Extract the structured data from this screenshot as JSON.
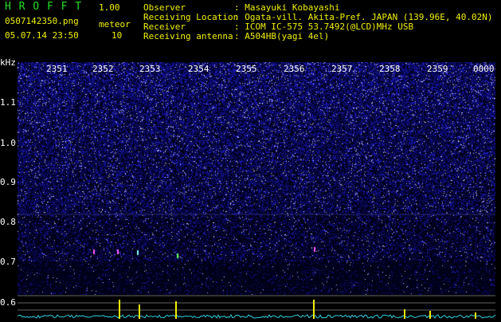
{
  "app": {
    "title": "H R O F F T",
    "version": "1.00"
  },
  "file": {
    "name": "0507142350.png",
    "datetime": "05.07.14 23:50"
  },
  "meteor": {
    "label": "meteor",
    "count": "10"
  },
  "info": [
    {
      "key": "Observer",
      "value": ": Masayuki Kobayashi"
    },
    {
      "key": "Receiving Location",
      "value": ": Ogata-vill. Akita-Pref. JAPAN (139.96E, 40.02N)"
    },
    {
      "key": "Receiver",
      "value": ": ICOM IC-575 53.7492(@LCD)MHz USB"
    },
    {
      "key": "Receiving antenna",
      "value": ": A504HB(yagi 4el)"
    }
  ],
  "y_axis": {
    "unit": "kHz",
    "ticks": [
      "1.1",
      "1.0",
      "0.9",
      "0.8",
      "0.7",
      "0.6"
    ]
  },
  "x_axis": {
    "ticks": [
      "2351",
      "2352",
      "2353",
      "2354",
      "2355",
      "2356",
      "2357",
      "2358",
      "2359",
      "0000"
    ]
  },
  "colors": {
    "background": "#000000",
    "label_green": "#22e022",
    "label_yellow": "#f0f000",
    "noise": "#2a2aa0",
    "trace": "#30d0e0",
    "spike": "#f0f000"
  }
}
